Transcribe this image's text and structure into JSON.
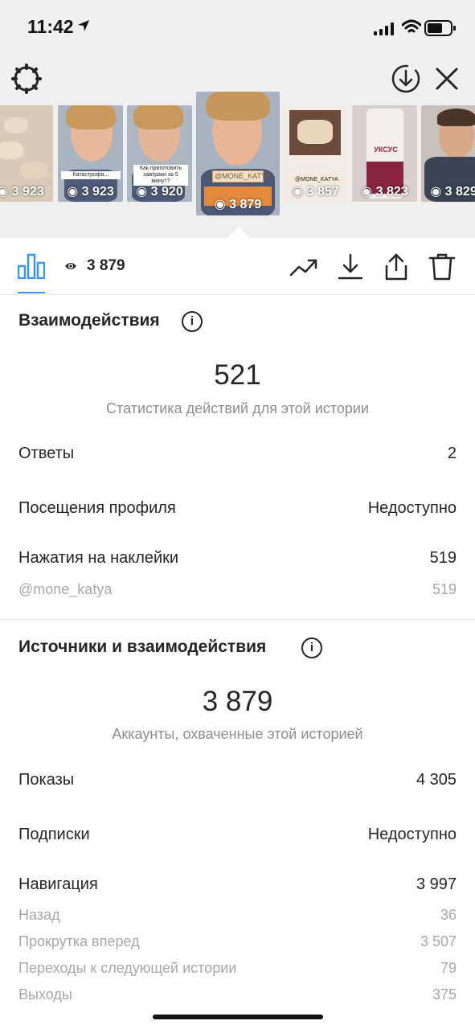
{
  "status_bar": {
    "time": "11:42"
  },
  "stories": [
    {
      "views": "3 923",
      "bg": "#d9cfc0"
    },
    {
      "views": "3 923",
      "bg": "#c9a890",
      "caption": "Катастрофа..."
    },
    {
      "views": "3 920",
      "bg": "#c8a48c",
      "caption": "Как приготовить завтраки за 5 минут?"
    },
    {
      "views": "3 879",
      "bg": "#b89478",
      "tag": "@MONE_KATYA",
      "selected": true
    },
    {
      "views": "3 857",
      "bg": "#e4ddd6",
      "tag": "@MONE_KATYA"
    },
    {
      "views": "3 823",
      "bg": "#cfc6c6",
      "tag": "УКСУС"
    },
    {
      "views": "3 829",
      "bg": "#a89888"
    }
  ],
  "toolbar": {
    "views_count": "3 879"
  },
  "interactions": {
    "title": "Взаимодействия",
    "total": "521",
    "caption": "Статистика действий для этой истории",
    "rows": [
      {
        "label": "Ответы",
        "value": "2"
      },
      {
        "label": "Посещения профиля",
        "value": "Недоступно"
      },
      {
        "label": "Нажатия на наклейки",
        "value": "519"
      }
    ],
    "sticker_sub": {
      "label": "@mone_katya",
      "value": "519"
    }
  },
  "discovery": {
    "title": "Источники и взаимодействия",
    "total": "3 879",
    "caption": "Аккаунты, охваченные этой историей",
    "rows": [
      {
        "label": "Показы",
        "value": "4 305"
      },
      {
        "label": "Подписки",
        "value": "Недоступно"
      },
      {
        "label": "Навигация",
        "value": "3 997"
      }
    ],
    "navigation_sub": [
      {
        "label": "Назад",
        "value": "36"
      },
      {
        "label": "Прокрутка вперед",
        "value": "3 507"
      },
      {
        "label": "Переходы к следующей истории",
        "value": "79"
      },
      {
        "label": "Выходы",
        "value": "375"
      }
    ]
  },
  "colors": {
    "accent": "#3897f0",
    "text": "#262626",
    "muted": "#8e8e8e"
  }
}
